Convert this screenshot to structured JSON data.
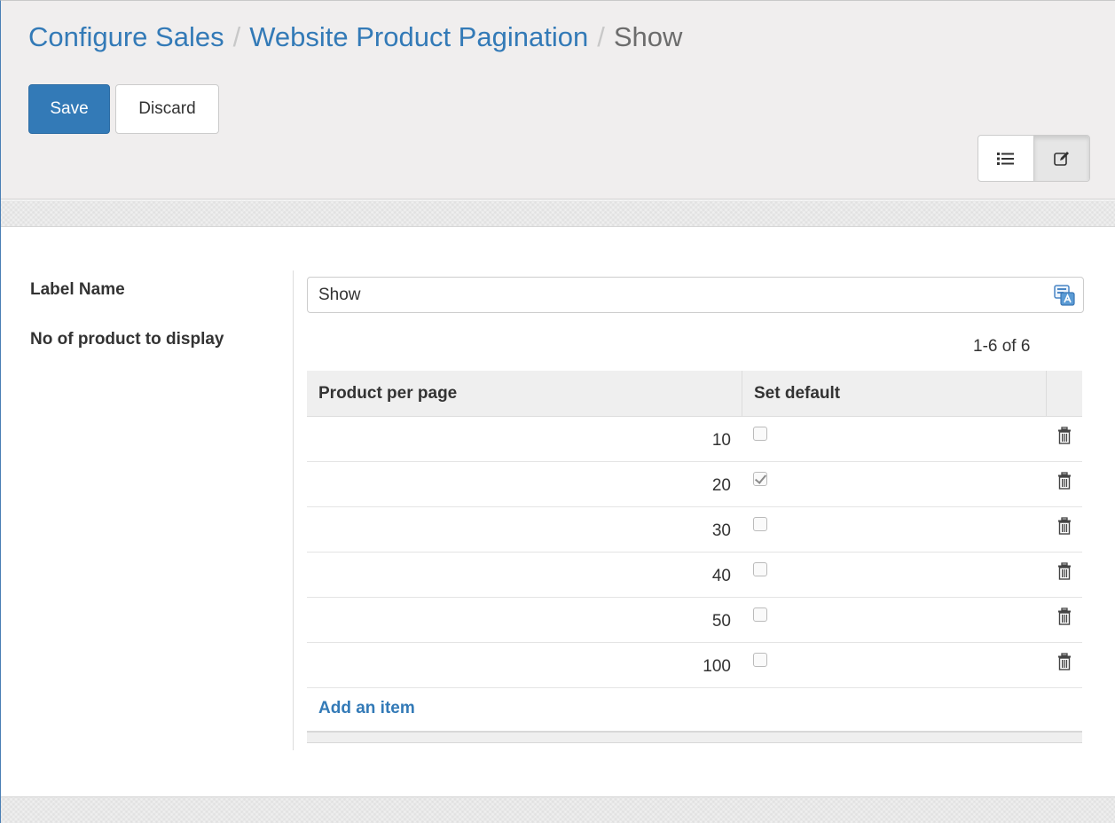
{
  "breadcrumb": {
    "items": [
      "Configure Sales",
      "Website Product Pagination"
    ],
    "current": "Show",
    "separator": "/"
  },
  "toolbar": {
    "save_label": "Save",
    "discard_label": "Discard"
  },
  "view_switcher": {
    "list_icon": "list-icon",
    "form_icon": "edit-icon",
    "active": "form"
  },
  "form": {
    "label_name_label": "Label Name",
    "label_name_value": "Show",
    "products_label": "No of product to display"
  },
  "list": {
    "pager": "1-6 of 6",
    "columns": [
      "Product per page",
      "Set default"
    ],
    "rows": [
      {
        "value": "10",
        "default": false
      },
      {
        "value": "20",
        "default": true
      },
      {
        "value": "30",
        "default": false
      },
      {
        "value": "40",
        "default": false
      },
      {
        "value": "50",
        "default": false
      },
      {
        "value": "100",
        "default": false
      }
    ],
    "add_item_label": "Add an item"
  },
  "colors": {
    "primary": "#337ab7",
    "panel_bg": "#f0eeee"
  }
}
